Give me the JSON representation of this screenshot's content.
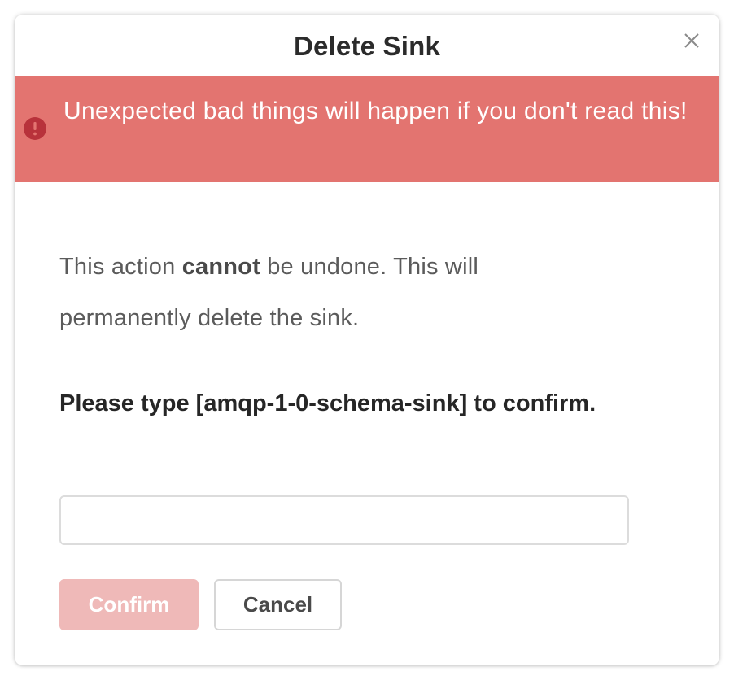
{
  "dialog": {
    "title": "Delete Sink",
    "close_icon": "close-icon"
  },
  "alert": {
    "icon": "exclamation-circle-icon",
    "message": "Unexpected bad things will happen if you don't read this!",
    "background_color": "#e37470",
    "icon_color": "#b8323b"
  },
  "body": {
    "text_before": "This action ",
    "text_emphasis": "cannot",
    "text_after": " be undone. This will permanently delete the sink."
  },
  "confirmation": {
    "label": "Please type [amqp-1-0-schema-sink] to confirm.",
    "input_value": "",
    "input_placeholder": ""
  },
  "buttons": {
    "confirm_label": "Confirm",
    "cancel_label": "Cancel",
    "confirm_color": "#efb9b8"
  }
}
